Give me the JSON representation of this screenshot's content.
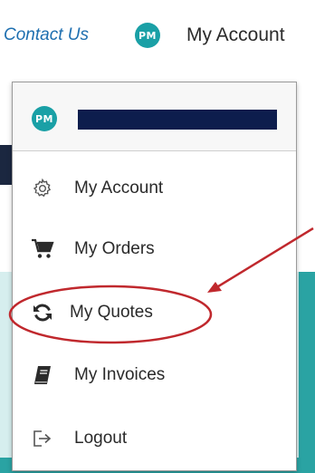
{
  "header": {
    "contact_label": "Contact Us",
    "avatar_initials": "PM",
    "account_label": "My Account"
  },
  "menu": {
    "user_initials": "PM",
    "items": [
      {
        "label": "My Account",
        "icon": "gear-icon"
      },
      {
        "label": "My Orders",
        "icon": "cart-icon"
      },
      {
        "label": "My Quotes",
        "icon": "refresh-icon"
      },
      {
        "label": "My Invoices",
        "icon": "book-icon"
      },
      {
        "label": "Logout",
        "icon": "logout-icon"
      }
    ]
  },
  "colors": {
    "link_blue": "#1e6fb0",
    "avatar_teal": "#1aa0a6",
    "redaction_navy": "#0d1d4d",
    "annotation_red": "#c0282d"
  }
}
